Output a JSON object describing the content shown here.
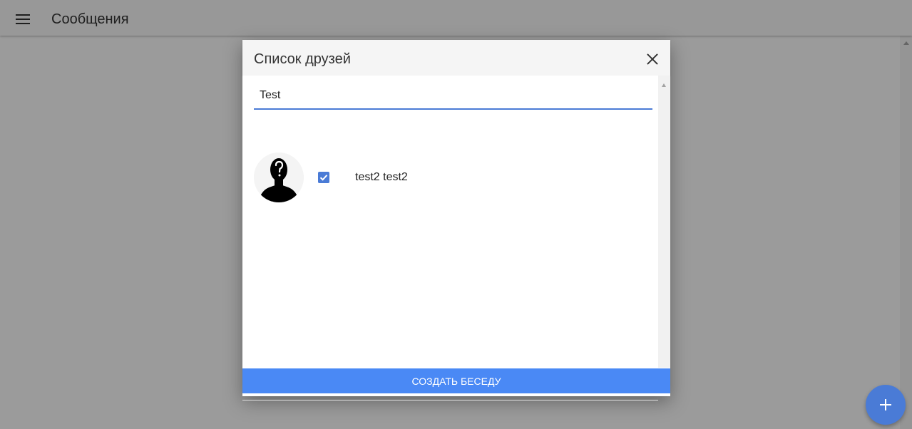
{
  "app": {
    "title": "Сообщения",
    "menu_icon": "hamburger-menu-icon"
  },
  "dialog": {
    "title": "Список друзей",
    "close_icon": "close-icon",
    "search": {
      "value": "Test",
      "placeholder": ""
    },
    "friends": [
      {
        "name": "test2 test2",
        "checked": true,
        "avatar_icon": "anonymous-silhouette-avatar"
      }
    ],
    "create_button_label": "СОЗДАТЬ БЕСЕДУ"
  },
  "fab": {
    "icon": "plus-icon"
  },
  "colors": {
    "accent": "#4a89f5",
    "fab": "#4a7bd6",
    "input_underline": "#4a7bd6"
  }
}
